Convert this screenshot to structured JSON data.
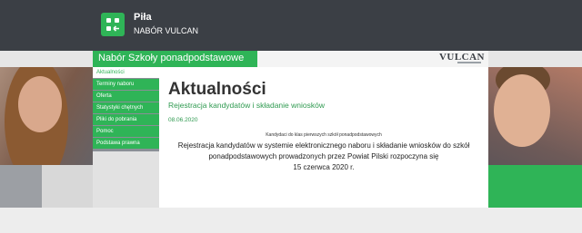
{
  "header": {
    "city": "Piła",
    "subtitle": "NABÓR VULCAN"
  },
  "titlebar": {
    "title": "Nabór Szkoły ponadpodstawowe",
    "brand": "VULCAN"
  },
  "nav": {
    "items": [
      {
        "label": "Aktualności",
        "active": true
      },
      {
        "label": "Terminy naboru",
        "active": false
      },
      {
        "label": "Oferta",
        "active": false
      },
      {
        "label": "Statystyki chętnych",
        "active": false
      },
      {
        "label": "Pliki do pobrania",
        "active": false
      },
      {
        "label": "Pomoc",
        "active": false
      },
      {
        "label": "Podstawa prawna",
        "active": false
      }
    ]
  },
  "main": {
    "page_title": "Aktualności",
    "article": {
      "title": "Rejestracja kandydatów i składanie wniosków",
      "date": "08.06.2020",
      "category": "Kandydaci do klas pierwszych szkół ponadpodstawowych",
      "body_lines": [
        "Rejestracja kandydatów w systemie elektronicznego naboru i składanie wniosków do szkół",
        "ponadpodstawowych prowadzonych przez Powiat Pilski rozpoczyna się",
        "15 czerwca 2020 r."
      ]
    }
  },
  "colors": {
    "accent_green": "#2fb457",
    "header_dark": "#3b3f45"
  },
  "icons": {
    "logo": "grid-arrow-icon"
  }
}
